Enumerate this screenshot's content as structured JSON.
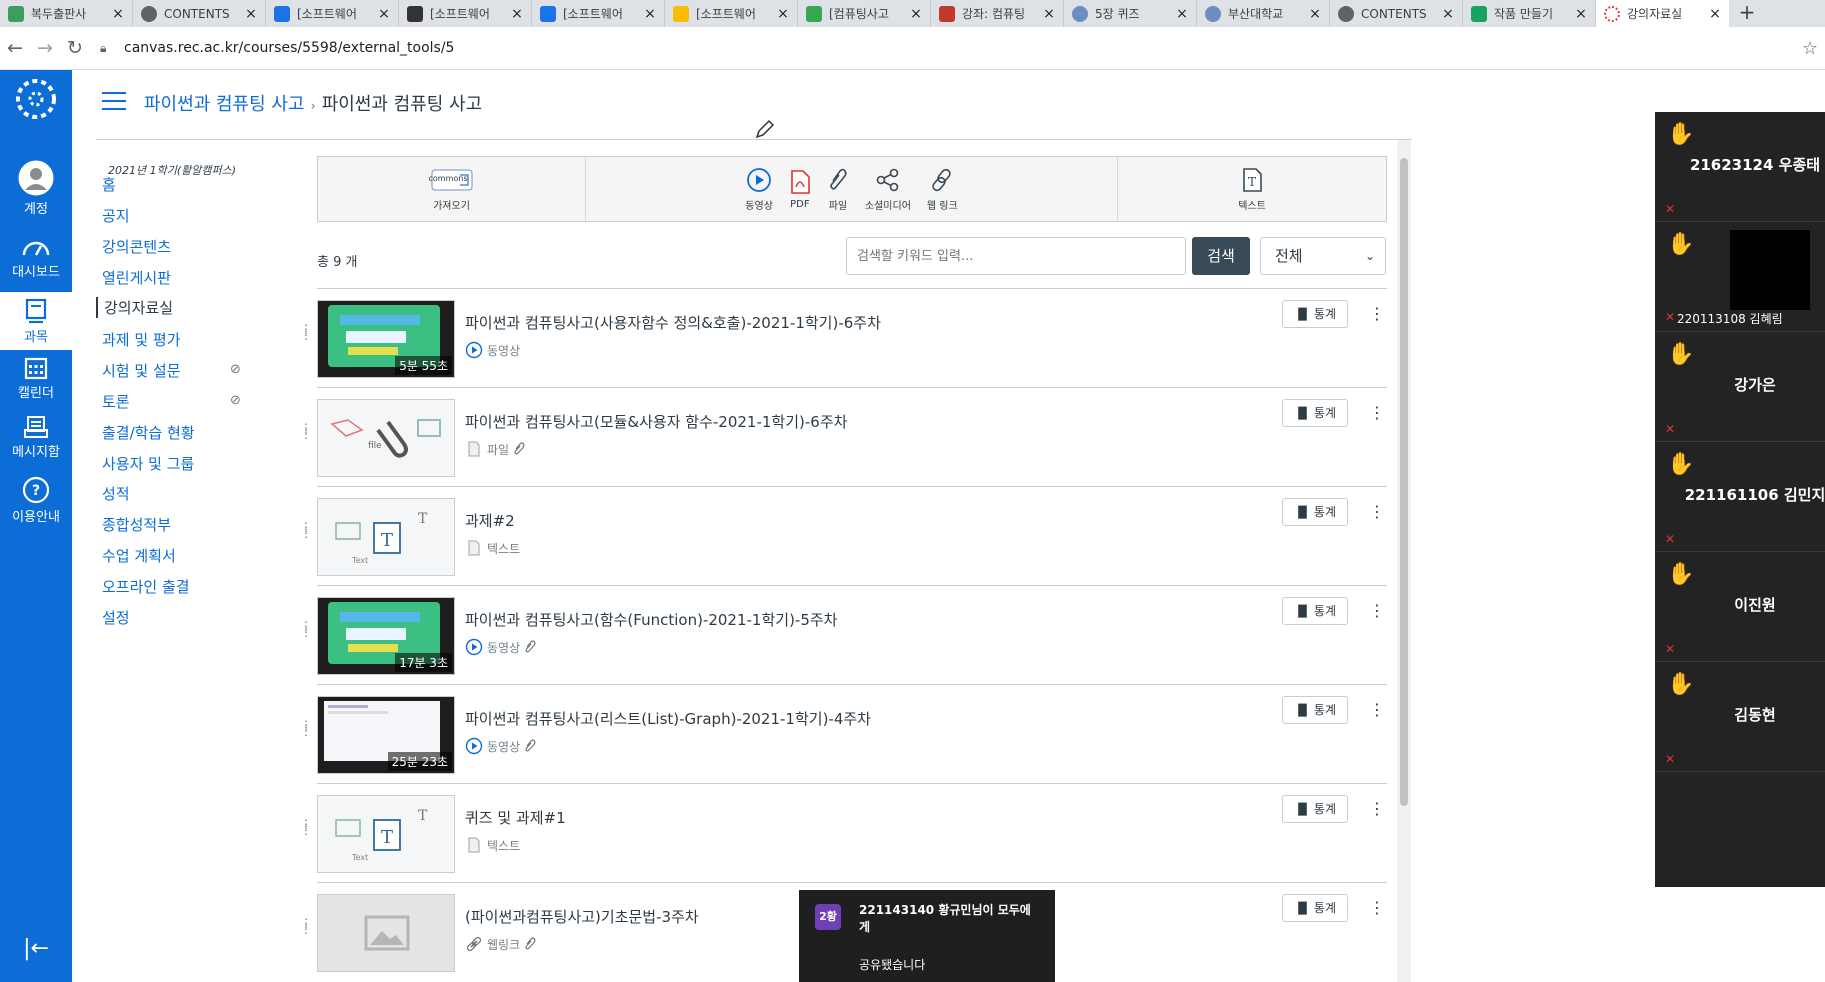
{
  "browser": {
    "tabs": [
      {
        "title": "복두출판사",
        "color": "#3c9d5c",
        "icon": "check-square-icon"
      },
      {
        "title": "CONTENTS",
        "color": "#5f6368",
        "icon": "globe-icon"
      },
      {
        "title": "[소프트웨어",
        "color": "#1a73e8",
        "icon": "classroom-icon"
      },
      {
        "title": "[소프트웨어",
        "color": "#333333",
        "icon": "classroom-icon"
      },
      {
        "title": "[소프트웨어",
        "color": "#1a73e8",
        "icon": "classroom-icon"
      },
      {
        "title": "[소프트웨어",
        "color": "#fbbc04",
        "icon": "drive-icon"
      },
      {
        "title": "[컴퓨팅사고",
        "color": "#34a853",
        "icon": "classroom-icon"
      },
      {
        "title": "강좌: 컴퓨팅",
        "color": "#c0392b",
        "icon": "moodle-icon"
      },
      {
        "title": "5장 퀴즈",
        "color": "#6c8ebf",
        "icon": "globe-icon"
      },
      {
        "title": "부산대학교",
        "color": "#6c8ebf",
        "icon": "globe-icon"
      },
      {
        "title": "CONTENTS",
        "color": "#5f6368",
        "icon": "globe-icon"
      },
      {
        "title": "작품 만들기",
        "color": "#1aa260",
        "icon": "sheet-icon"
      },
      {
        "title": "강의자료실",
        "color": "#e03a3e",
        "icon": "canvas-icon"
      }
    ],
    "new_tab": "+",
    "url": "canvas.rec.ac.kr/courses/5598/external_tools/5"
  },
  "global_nav": {
    "items": [
      {
        "label": "계정"
      },
      {
        "label": "대시보드"
      },
      {
        "label": "과목"
      },
      {
        "label": "캘린더"
      },
      {
        "label": "메시지함"
      },
      {
        "label": "이용안내"
      }
    ]
  },
  "breadcrumb": {
    "course": "파이썬과 컴퓨팅 사고",
    "current": "파이썬과 컴퓨팅 사고",
    "separator": "›"
  },
  "course_nav": {
    "term": "2021년 1학기(활알캠퍼스)",
    "items": [
      {
        "label": "홈"
      },
      {
        "label": "공지"
      },
      {
        "label": "강의콘텐츠"
      },
      {
        "label": "열린게시판"
      },
      {
        "label": "강의자료실"
      },
      {
        "label": "과제 및 평가"
      },
      {
        "label": "시험 및 설문"
      },
      {
        "label": "토론"
      },
      {
        "label": "출결/학습 현황"
      },
      {
        "label": "사용자 및 그룹"
      },
      {
        "label": "성적"
      },
      {
        "label": "종합성적부"
      },
      {
        "label": "수업 계획서"
      },
      {
        "label": "오프라인 출결"
      },
      {
        "label": "설정"
      }
    ]
  },
  "toolbar": {
    "import_logo": "commons",
    "import_label": "가져오기",
    "video": "동영상",
    "pdf": "PDF",
    "file": "파일",
    "social": "소셜미디어",
    "weblink": "웹 링크",
    "text": "텍스트"
  },
  "list_header": {
    "count": "총 9 개",
    "search_placeholder": "검색할 키워드 입력...",
    "search_button": "검색",
    "filter_value": "전체"
  },
  "items": [
    {
      "title": "파이썬과 컴퓨팅사고(사용자함수 정의&호출)-2021-1학기)-6주차",
      "type": "동영상",
      "duration": "5분 55초",
      "thumb": "video-green",
      "attach": false
    },
    {
      "title": "파이썬과 컴퓨팅사고(모듈&사용자 함수-2021-1학기)-6주차",
      "type": "파일",
      "duration": "",
      "thumb": "file",
      "attach": true
    },
    {
      "title": "과제#2",
      "type": "텍스트",
      "duration": "",
      "thumb": "text",
      "attach": false
    },
    {
      "title": "파이썬과 컴퓨팅사고(함수(Function)-2021-1학기)-5주차",
      "type": "동영상",
      "duration": "17분 3초",
      "thumb": "video-green",
      "attach": true
    },
    {
      "title": "파이썬과 컴퓨팅사고(리스트(List)-Graph)-2021-1학기)-4주차",
      "type": "동영상",
      "duration": "25분 23초",
      "thumb": "video-white",
      "attach": true
    },
    {
      "title": "퀴즈 및 과제#1",
      "type": "텍스트",
      "duration": "",
      "thumb": "text",
      "attach": false
    },
    {
      "title": "(파이썬과컴퓨팅사고)기초문법-3주차",
      "type": "웹링크",
      "duration": "",
      "thumb": "image",
      "attach": true
    }
  ],
  "stats_label": "통계",
  "participants": [
    {
      "name": "21623124 우종태",
      "video": false
    },
    {
      "name": "220113108 김혜림",
      "video": true
    },
    {
      "name": "강가은",
      "video": false
    },
    {
      "name": "221161106 김민지",
      "video": false
    },
    {
      "name": "이진원",
      "video": false
    },
    {
      "name": "김동현",
      "video": false
    }
  ],
  "toast": {
    "avatar": "2황",
    "message": "221143140 황규민님이 모두에게",
    "sub": "공유됐습니다"
  }
}
